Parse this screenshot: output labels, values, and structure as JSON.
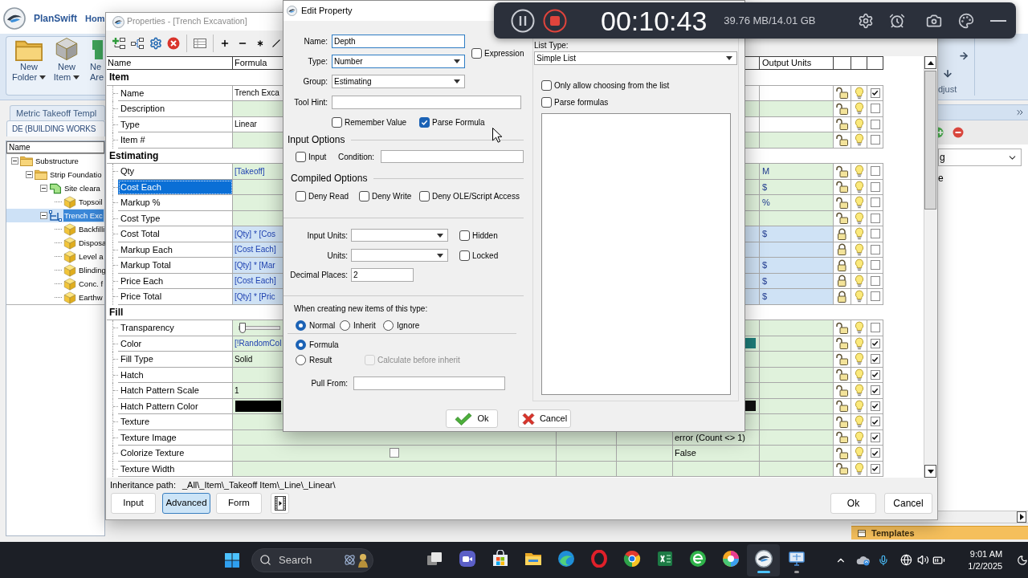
{
  "app": {
    "brand": "PlanSwift",
    "menu_tab": "Hom",
    "ribbon": [
      {
        "kind": "folder",
        "lines": [
          "New",
          "Folder"
        ],
        "menu": true
      },
      {
        "kind": "cube",
        "lines": [
          "New",
          "Item"
        ],
        "menu": true
      },
      {
        "kind": "area",
        "lines": [
          "Ne",
          "Are"
        ]
      }
    ],
    "ribbon_label": "djust",
    "tabs": [
      {
        "label": "Metric Takeoff Templ",
        "selected": false
      },
      {
        "label": "DE (BUILDING WORKS",
        "selected": true
      }
    ],
    "tree": {
      "column": "Name",
      "items": [
        {
          "label": "Substructure",
          "kind": "folder",
          "expanded": true,
          "selected": false,
          "children": [
            {
              "label": "Strip Foundatio",
              "kind": "folder",
              "expanded": true,
              "selected": false,
              "children": [
                {
                  "label": "Site cleara",
                  "kind": "area",
                  "expanded": true,
                  "selected": false,
                  "children": [
                    {
                      "label": "Topsoil",
                      "kind": "item",
                      "selected": false
                    }
                  ]
                },
                {
                  "label": "Trench Exc",
                  "kind": "line",
                  "expanded": true,
                  "selected": true,
                  "children": [
                    {
                      "label": "Backfilli",
                      "kind": "item",
                      "selected": false
                    },
                    {
                      "label": "Disposa",
                      "kind": "item",
                      "selected": false
                    },
                    {
                      "label": "Level a",
                      "kind": "item",
                      "selected": false
                    },
                    {
                      "label": "Blinding",
                      "kind": "item",
                      "selected": false
                    },
                    {
                      "label": "Conc. f",
                      "kind": "item",
                      "selected": false
                    },
                    {
                      "label": "Earthw",
                      "kind": "item",
                      "selected": false
                    }
                  ]
                }
              ]
            }
          ]
        }
      ]
    },
    "side_panel": {
      "dropdown_value": "g",
      "list_text": "e",
      "footer": "Templates"
    }
  },
  "properties": {
    "title": "Properties - [Trench Excavation]",
    "columns": {
      "name": "Name",
      "formula": "Formula",
      "output_units": "Output Units"
    },
    "groups": [
      {
        "title": "Item",
        "rows": [
          {
            "name": "Name",
            "kind": "text",
            "formula": "Trench Exca",
            "expression": false,
            "color": "#ffffff",
            "selected": false,
            "locked": false,
            "checked": true
          },
          {
            "name": "Description",
            "kind": "text",
            "color": "#e0f2dc",
            "selected": false,
            "locked": false,
            "checked": false
          },
          {
            "name": "Type",
            "kind": "text",
            "formula": "Linear",
            "expression": false,
            "color": "#ffffff",
            "selected": false,
            "locked": false,
            "checked": false
          },
          {
            "name": "Item #",
            "kind": "text",
            "color": "#e0f2dc",
            "selected": false,
            "locked": false,
            "checked": false
          }
        ]
      },
      {
        "title": "Estimating",
        "rows": [
          {
            "name": "Qty",
            "kind": "text",
            "formula": "[Takeoff]",
            "expression": true,
            "units": "M",
            "color": "#e0f2dc",
            "selected": false,
            "locked": false,
            "checked": false
          },
          {
            "name": "Cost Each",
            "kind": "text",
            "units": "$",
            "color": "#e0f2dc",
            "selected": true,
            "locked": false,
            "checked": false
          },
          {
            "name": "Markup %",
            "kind": "text",
            "units": "%",
            "color": "#e0f2dc",
            "selected": false,
            "locked": false,
            "checked": false
          },
          {
            "name": "Cost Type",
            "kind": "text",
            "color": "#e0f2dc",
            "selected": false,
            "locked": false,
            "checked": false
          },
          {
            "name": "Cost Total",
            "kind": "text",
            "formula": "[Qty] * [Cos",
            "expression": true,
            "units": "$",
            "color": "#cfe2f5",
            "selected": false,
            "locked": true,
            "checked": false
          },
          {
            "name": "Markup Each",
            "kind": "text",
            "formula": "[Cost Each]",
            "expression": true,
            "color": "#cfe2f5",
            "selected": false,
            "locked": true,
            "checked": false
          },
          {
            "name": "Markup Total",
            "kind": "text",
            "formula": "[Qty] * [Mar",
            "expression": true,
            "units": "$",
            "color": "#cfe2f5",
            "selected": false,
            "locked": true,
            "checked": false
          },
          {
            "name": "Price Each",
            "kind": "text",
            "formula": "[Cost Each]",
            "expression": true,
            "units": "$",
            "color": "#cfe2f5",
            "selected": false,
            "locked": true,
            "checked": false
          },
          {
            "name": "Price Total",
            "kind": "text",
            "formula": "[Qty] * [Pric",
            "expression": true,
            "units": "$",
            "color": "#cfe2f5",
            "selected": false,
            "locked": true,
            "checked": false
          }
        ]
      },
      {
        "title": "Fill",
        "rows": [
          {
            "name": "Transparency",
            "kind": "slider",
            "level": 0,
            "color": "#e0f2dc",
            "selected": false,
            "locked": false,
            "checked": false
          },
          {
            "name": "Color",
            "kind": "text",
            "formula": "[!RandomCol",
            "expression": true,
            "result_swatch": {
              "color": "#1e7f7b"
            },
            "color": "#e0f2dc",
            "selected": false,
            "locked": false,
            "checked": true
          },
          {
            "name": "Fill Type",
            "kind": "text",
            "formula": "Solid",
            "expression": false,
            "color": "#e0f2dc",
            "selected": false,
            "locked": false,
            "checked": true
          },
          {
            "name": "Hatch",
            "kind": "text",
            "color": "#e0f2dc",
            "selected": false,
            "locked": false,
            "checked": true
          },
          {
            "name": "Hatch Pattern Scale",
            "kind": "text",
            "formula": "1",
            "expression": false,
            "color": "#e0f2dc",
            "selected": false,
            "locked": false,
            "checked": true
          },
          {
            "name": "Hatch Pattern Color",
            "kind": "swatch",
            "swatch": {
              "color": "#000000"
            },
            "result_swatch": {
              "color": "#111111"
            },
            "color": "#e0f2dc",
            "selected": false,
            "locked": false,
            "checked": true
          },
          {
            "name": "Texture",
            "kind": "text",
            "color": "#e0f2dc",
            "selected": false,
            "locked": false,
            "checked": true
          },
          {
            "name": "Texture Image",
            "kind": "text",
            "result": "error (Count <> 1)",
            "color": "#e0f2dc",
            "selected": false,
            "locked": false,
            "checked": true
          },
          {
            "name": "Colorize Texture",
            "kind": "checkbox",
            "formula_checked": false,
            "result": "False",
            "color": "#e0f2dc",
            "selected": false,
            "locked": false,
            "checked": true
          },
          {
            "name": "Texture Width",
            "kind": "text",
            "color": "#e0f2dc",
            "selected": false,
            "locked": false,
            "checked": true
          }
        ]
      }
    ],
    "inheritance": {
      "label": "Inheritance path:",
      "value": "_All\\_Item\\_Takeoff Item\\_Line\\_Linear\\"
    },
    "modes": [
      {
        "label": "Input",
        "selected": false
      },
      {
        "label": "Advanced",
        "selected": true
      },
      {
        "label": "Form",
        "selected": false
      }
    ],
    "buttons": [
      "Ok",
      "Cancel"
    ]
  },
  "edit_property": {
    "title": "Edit Property",
    "fields": [
      {
        "label": "Name:",
        "value": "Depth",
        "kind": "text",
        "focused": true
      },
      {
        "label": "Type:",
        "value": "Number",
        "kind": "select",
        "focused": true
      },
      {
        "label": "Group:",
        "value": "Estimating",
        "kind": "select",
        "focused": false
      }
    ],
    "expression": {
      "label": "Expression",
      "checked": false
    },
    "tool_hint": {
      "label": "Tool Hint:"
    },
    "flags": [
      {
        "label": "Remember Value",
        "checked": false
      },
      {
        "label": "Parse Formula",
        "checked": true
      }
    ],
    "input_options": {
      "title": "Input Options",
      "input": {
        "label": "Input",
        "checked": false
      },
      "condition": {
        "label": "Condition:"
      }
    },
    "compiled_options": {
      "title": "Compiled Options",
      "options": [
        {
          "label": "Deny Read",
          "checked": false
        },
        {
          "label": "Deny Write",
          "checked": false
        },
        {
          "label": "Deny OLE/Script Access",
          "checked": false
        }
      ]
    },
    "units": [
      {
        "label": "Input Units:",
        "option": {
          "label": "Hidden",
          "checked": false
        }
      },
      {
        "label": "Units:",
        "option": {
          "label": "Locked",
          "checked": false
        }
      }
    ],
    "decimal_places": {
      "label": "Decimal Places:",
      "value": "2"
    },
    "creation": {
      "title": "When creating new items of this type:",
      "modes": [
        {
          "label": "Normal",
          "selected": true
        },
        {
          "label": "Inherit",
          "selected": false
        },
        {
          "label": "Ignore",
          "selected": false
        }
      ],
      "sources": [
        {
          "label": "Formula",
          "selected": true
        },
        {
          "label": "Result",
          "selected": false
        }
      ],
      "calculate_before_inherit": {
        "label": "Calculate before inherit",
        "checked": false,
        "disabled": true
      }
    },
    "pull_from": {
      "label": "Pull From:"
    },
    "list": {
      "label": "List Type:",
      "value": "Simple List",
      "options": [
        {
          "label": "Only allow choosing from the list",
          "checked": false
        },
        {
          "label": "Parse formulas",
          "checked": false
        }
      ]
    },
    "buttons": [
      {
        "label": "Ok",
        "kind": "ok"
      },
      {
        "label": "Cancel",
        "kind": "cancel"
      }
    ]
  },
  "recorder": {
    "time": "00:10:43",
    "storage": "39.76 MB/14.01 GB"
  },
  "taskbar": {
    "search": {
      "placeholder": "Search"
    },
    "apps": [
      {
        "kind": "task-view",
        "running": false,
        "active": false
      },
      {
        "kind": "chat",
        "running": false,
        "active": false
      },
      {
        "kind": "store",
        "running": false,
        "active": false
      },
      {
        "kind": "folder",
        "running": false,
        "active": false
      },
      {
        "kind": "swirl",
        "running": false,
        "active": false
      },
      {
        "kind": "ring",
        "running": false,
        "active": false
      },
      {
        "kind": "tricolor",
        "running": false,
        "active": false
      },
      {
        "kind": "spreadsheet",
        "running": false,
        "active": false
      },
      {
        "kind": "green-circle",
        "running": false,
        "active": false
      },
      {
        "kind": "color-wheel",
        "running": false,
        "active": false
      },
      {
        "kind": "logo",
        "running": true,
        "active": true
      },
      {
        "kind": "monitor",
        "running": true,
        "active": false
      }
    ],
    "clock": {
      "time": "9:01 AM",
      "date": "1/2/2025"
    }
  }
}
